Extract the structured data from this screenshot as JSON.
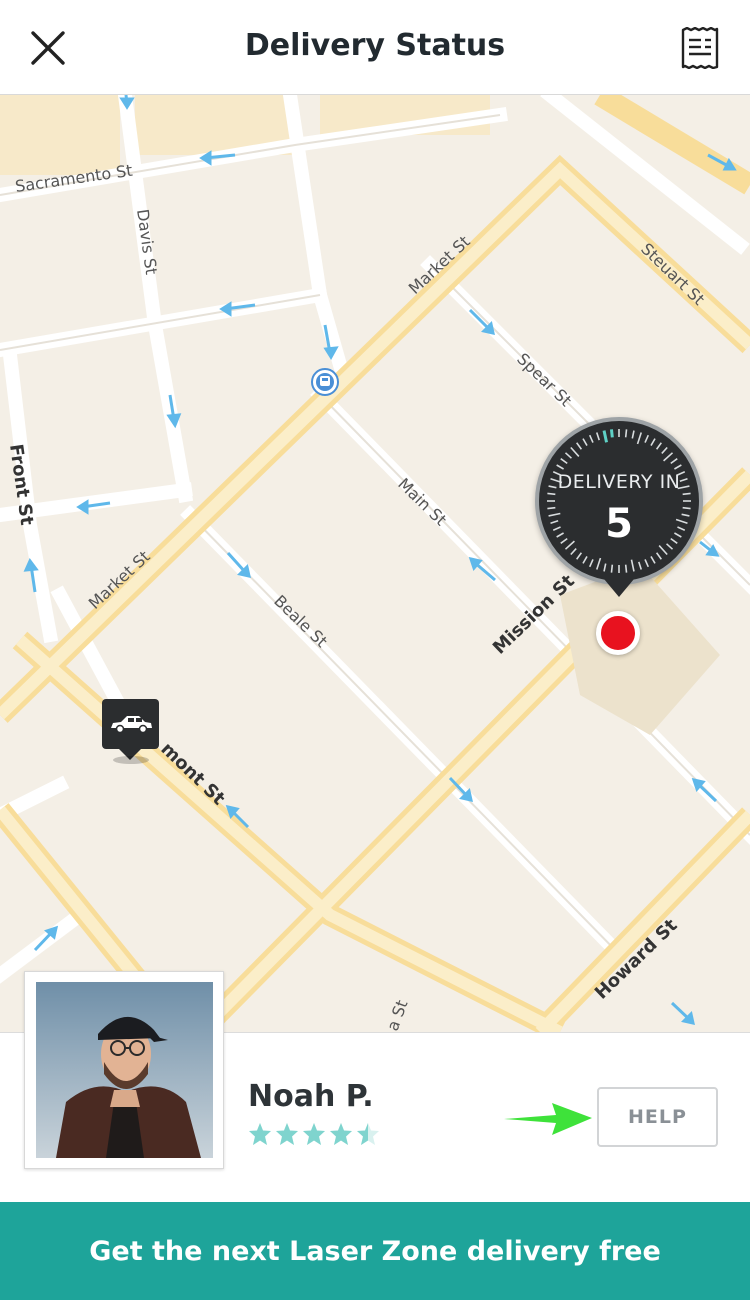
{
  "header": {
    "title": "Delivery Status",
    "close_icon": "close-icon",
    "receipt_icon": "receipt-icon"
  },
  "map": {
    "streets": {
      "sacramento": "Sacramento St",
      "davis": "Davis St",
      "market_top": "Market St",
      "market_bottom": "Market St",
      "front": "Front St",
      "steuart": "Steuart St",
      "spear": "Spear St",
      "main": "Main St",
      "beale": "Beale St",
      "mission": "Mission St",
      "fremont": "mont St",
      "howard": "Howard St",
      "first": "a St"
    },
    "transit_icon": "transit-station-icon",
    "car_icon": "car-icon",
    "destination_icon": "destination-pin-icon"
  },
  "timer": {
    "label": "DELIVERY IN",
    "value": "5",
    "progress_fraction": 0.03
  },
  "driver": {
    "name": "Noah P.",
    "rating": 4.5,
    "rating_max": 5,
    "star_color": "#7fd4ce",
    "photo_alt": "driver-photo"
  },
  "help_button": {
    "label": "HELP"
  },
  "promo": {
    "text": "Get the next Laser Zone delivery free",
    "color": "#1ea49a"
  },
  "annotation": {
    "arrow_color": "#3ee23a"
  }
}
